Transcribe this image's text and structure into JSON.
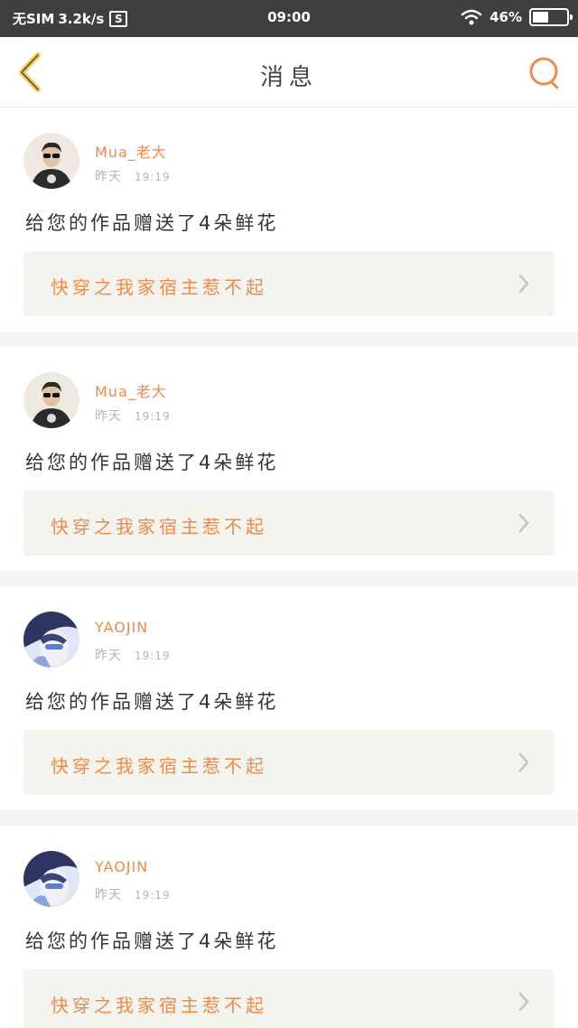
{
  "status_bar": {
    "carrier": "无SIM",
    "speed": "3.2k/s",
    "sim_icon": "S",
    "time": "09:00",
    "battery": "46",
    "battery_level": 0.46
  },
  "header": {
    "title": "消息",
    "back_icon": "chevron-left-icon",
    "search_icon": "search-icon"
  },
  "colors": {
    "accent": "#f08a4b",
    "back_arrow": "#f2c94c",
    "avatar_dark": "#2b2b2b",
    "avatar_anime": "#8aa4d6"
  },
  "messages": [
    {
      "name": "Mua_老大",
      "day": "昨天",
      "time": "19:19",
      "text": "给您的作品赠送了4朵鲜花",
      "book": "快穿之我家宿主惹不起",
      "avatar": "person-avatar"
    },
    {
      "name": "Mua_老大",
      "day": "昨天",
      "time": "19:19",
      "text": "给您的作品赠送了4朵鲜花",
      "book": "快穿之我家宿主惹不起",
      "avatar": "person-avatar"
    },
    {
      "name": "YAOJIN",
      "day": "昨天",
      "time": "19:19",
      "text": "给您的作品赠送了4朵鲜花",
      "book": "快穿之我家宿主惹不起",
      "avatar": "anime-avatar"
    },
    {
      "name": "YAOJIN",
      "day": "昨天",
      "time": "19:19",
      "text": "给您的作品赠送了4朵鲜花",
      "book": "快穿之我家宿主惹不起",
      "avatar": "anime-avatar"
    }
  ]
}
